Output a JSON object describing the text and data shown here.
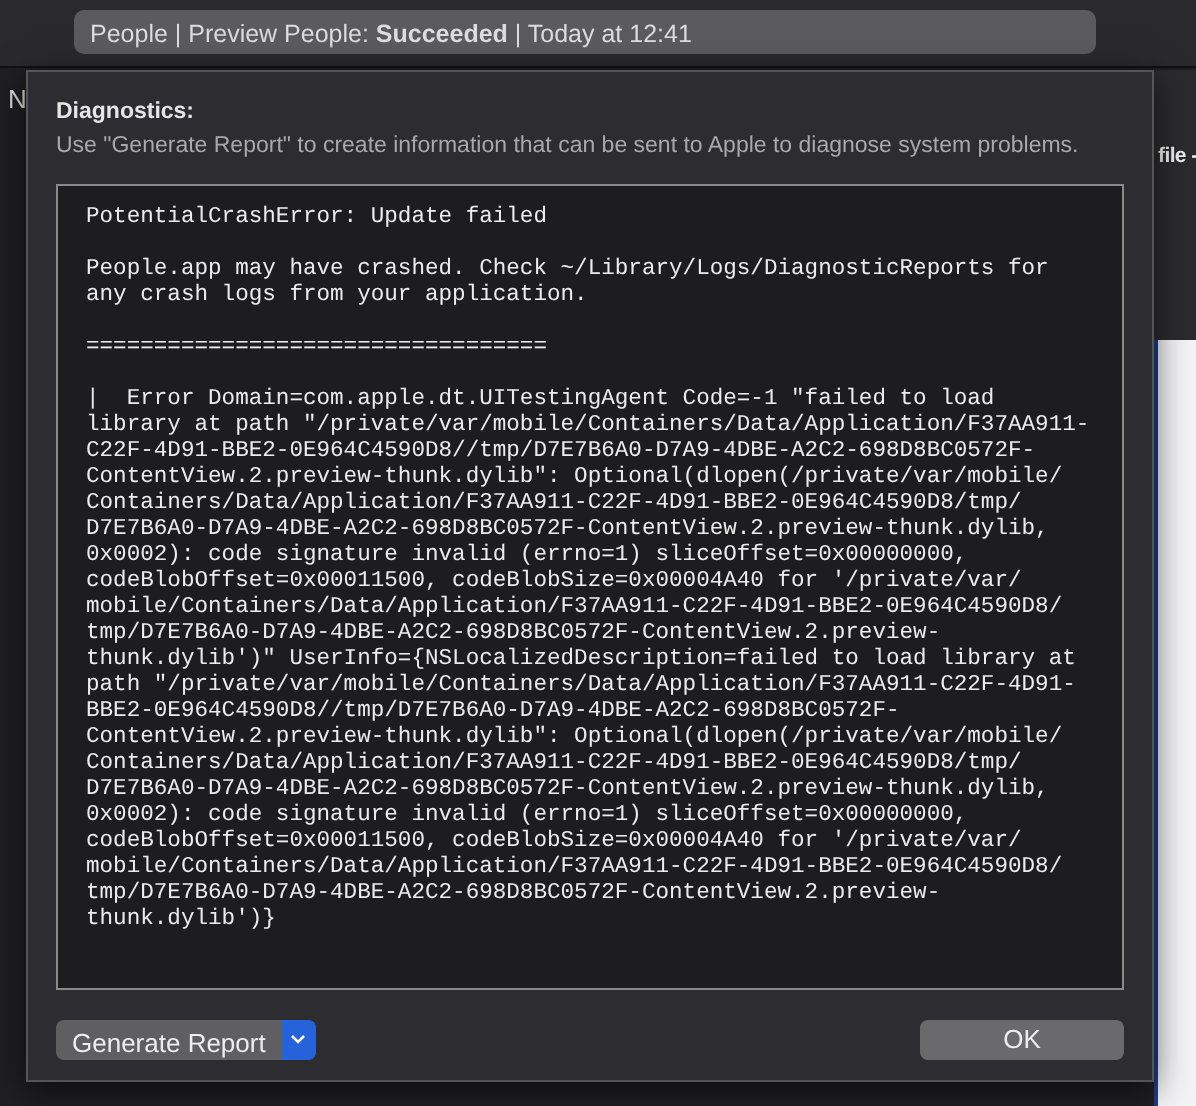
{
  "activity": {
    "text": "People | Preview People: **Succeeded** | Today at 12:41"
  },
  "background": {
    "left_text": "N",
    "right_text": "file -"
  },
  "dialog": {
    "heading": "Diagnostics:",
    "description": "Use \"Generate Report\" to create information that can be sent to Apple to diagnose system problems.",
    "log": [
      "PotentialCrashError: Update failed",
      "People.app may have crashed. Check ~/Library/Logs/DiagnosticReports for\nany crash logs from your application.",
      "==================================",
      "|  Error Domain=com.apple.dt.UITestingAgent Code=-1 \"failed to load\nlibrary at path \"/private/var/mobile/Containers/Data/Application/F37AA911-\nC22F-4D91-BBE2-0E964C4590D8//tmp/D7E7B6A0-D7A9-4DBE-A2C2-698D8BC0572F-\nContentView.2.preview-thunk.dylib\": Optional(dlopen(/private/var/mobile/\nContainers/Data/Application/F37AA911-C22F-4D91-BBE2-0E964C4590D8/tmp/\nD7E7B6A0-D7A9-4DBE-A2C2-698D8BC0572F-ContentView.2.preview-thunk.dylib,\n0x0002): code signature invalid (errno=1) sliceOffset=0x00000000,\ncodeBlobOffset=0x00011500, codeBlobSize=0x00004A40 for '/private/var/\nmobile/Containers/Data/Application/F37AA911-C22F-4D91-BBE2-0E964C4590D8/\ntmp/D7E7B6A0-D7A9-4DBE-A2C2-698D8BC0572F-ContentView.2.preview-\nthunk.dylib')\" UserInfo={NSLocalizedDescription=failed to load library at\npath \"/private/var/mobile/Containers/Data/Application/F37AA911-C22F-4D91-\nBBE2-0E964C4590D8//tmp/D7E7B6A0-D7A9-4DBE-A2C2-698D8BC0572F-\nContentView.2.preview-thunk.dylib\": Optional(dlopen(/private/var/mobile/\nContainers/Data/Application/F37AA911-C22F-4D91-BBE2-0E964C4590D8/tmp/\nD7E7B6A0-D7A9-4DBE-A2C2-698D8BC0572F-ContentView.2.preview-thunk.dylib,\n0x0002): code signature invalid (errno=1) sliceOffset=0x00000000,\ncodeBlobOffset=0x00011500, codeBlobSize=0x00004A40 for '/private/var/\nmobile/Containers/Data/Application/F37AA911-C22F-4D91-BBE2-0E964C4590D8/\ntmp/D7E7B6A0-D7A9-4DBE-A2C2-698D8BC0572F-ContentView.2.preview-\nthunk.dylib')}"
    ],
    "buttons": [
      {
        "label": "Generate Report",
        "kind": "menu"
      },
      {
        "label": "OK",
        "kind": "plain"
      }
    ]
  }
}
